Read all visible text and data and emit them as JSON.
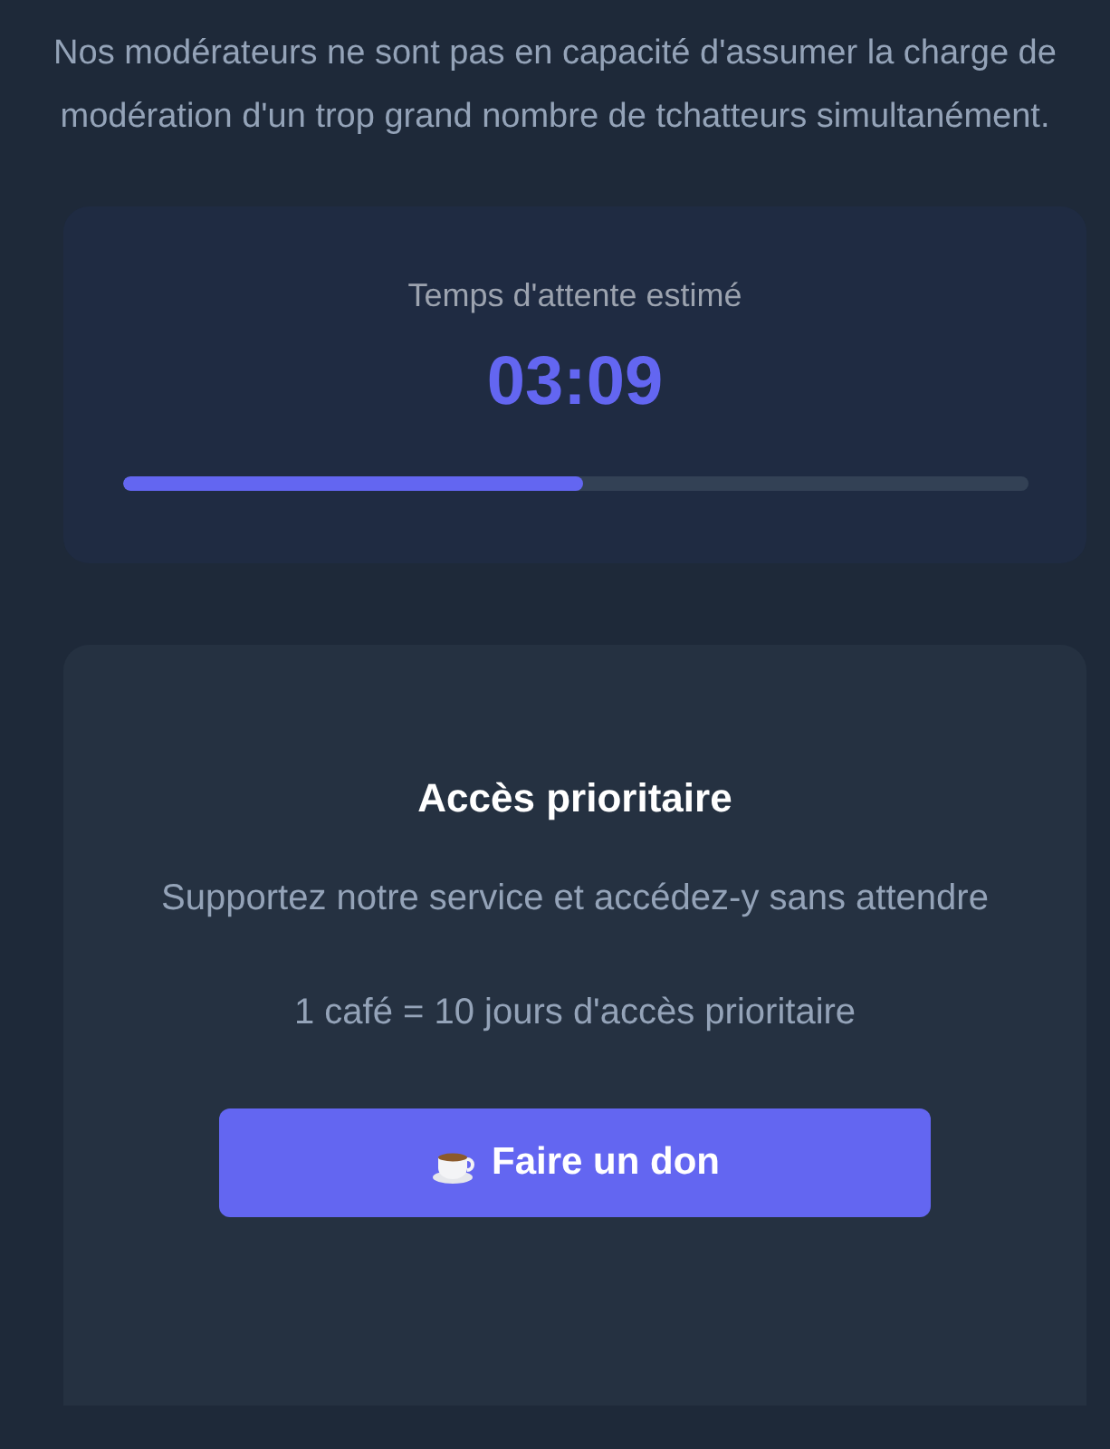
{
  "notice": "Nos modérateurs ne sont pas en capacité d'assumer la charge de modération d'un trop grand nombre de tchatteurs simultanément.",
  "wait": {
    "label": "Temps d'attente estimé",
    "time": "03:09",
    "progress": {
      "level": 0.508
    }
  },
  "priority": {
    "title": "Accès prioritaire",
    "description": "Supportez notre service et accédez-y sans attendre",
    "offer": "1 café = 10 jours d'accès prioritaire",
    "button": "Faire un don"
  }
}
